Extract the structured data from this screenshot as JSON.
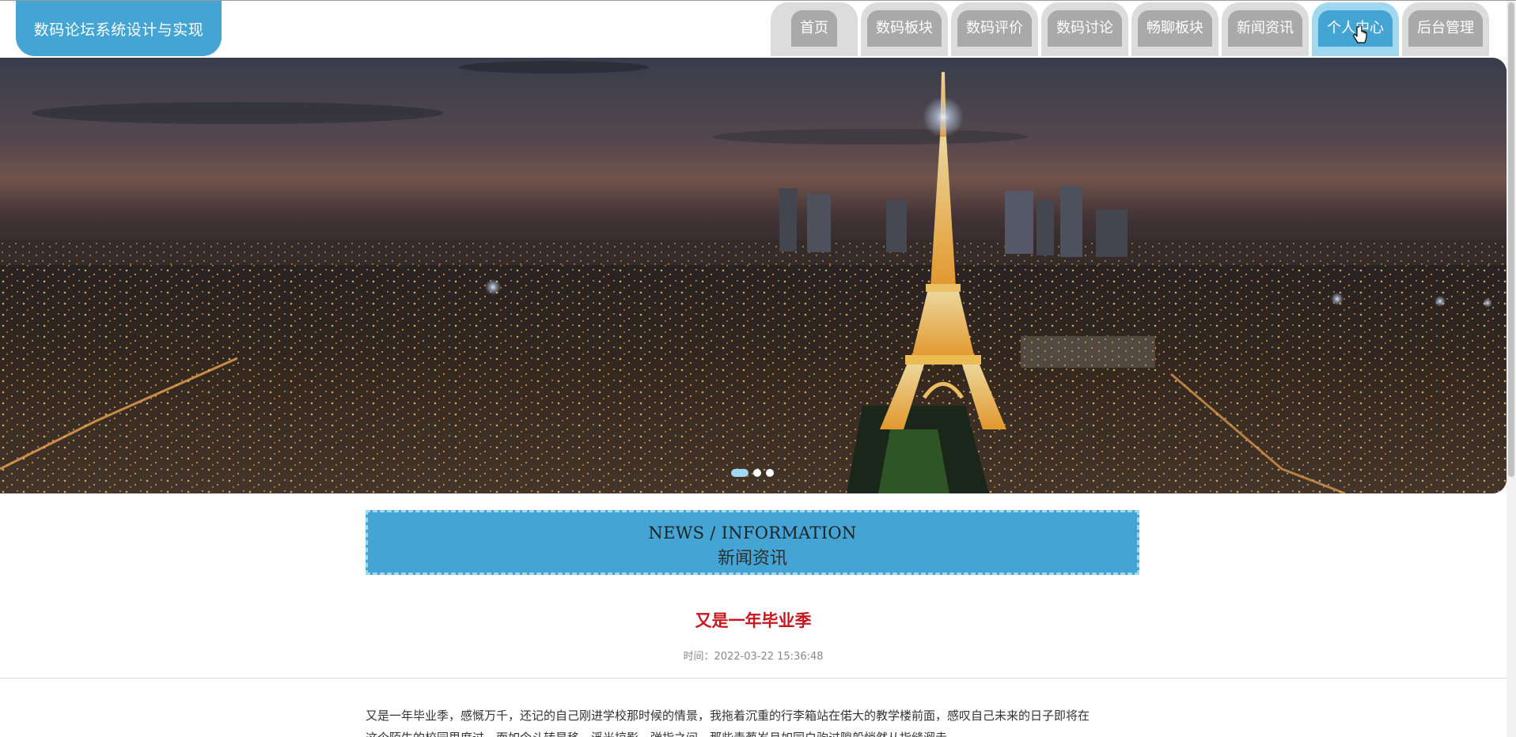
{
  "site": {
    "title": "数码论坛系统设计与实现"
  },
  "nav": {
    "items": [
      {
        "label": "首页",
        "active": false
      },
      {
        "label": "数码板块",
        "active": false
      },
      {
        "label": "数码评价",
        "active": false
      },
      {
        "label": "数码讨论",
        "active": false
      },
      {
        "label": "畅聊板块",
        "active": false
      },
      {
        "label": "新闻资讯",
        "active": false
      },
      {
        "label": "个人中心",
        "active": true
      },
      {
        "label": "后台管理",
        "active": false
      }
    ]
  },
  "banner": {
    "slides": 3,
    "active_slide": 1,
    "image": "night-city-eiffel-tower"
  },
  "section": {
    "title_en": "NEWS / INFORMATION",
    "title_cn": "新闻资讯"
  },
  "article": {
    "title": "又是一年毕业季",
    "meta": "时间：2022-03-22 15:36:48",
    "body_line1": "又是一年毕业季，感慨万千，还记的自己刚进学校那时候的情景，我拖着沉重的行李箱站在偌大的教学楼前面，感叹自己未来的日子即将在",
    "body_line2": "这个陌生的校园里度过，而如今斗转星移，浮光掠影，弹指之间，那些青葱岁月如同白驹过隙般悄然从指缝溜走。"
  },
  "colors": {
    "accent": "#44a4d4",
    "accent_light": "#9fd8ef",
    "tab_inactive": "#a9a9a9",
    "article_title": "#c7161d"
  }
}
